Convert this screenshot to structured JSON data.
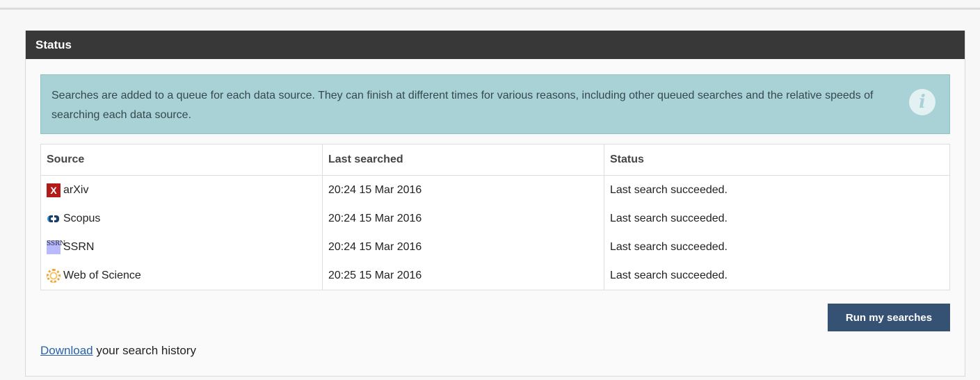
{
  "panel": {
    "title": "Status"
  },
  "info": {
    "text": "Searches are added to a queue for each data source. They can finish at different times for various reasons, including other queued searches and the relative speeds of searching each data source.",
    "icon": "info-icon",
    "icon_glyph": "i"
  },
  "table": {
    "headers": [
      "Source",
      "Last searched",
      "Status"
    ],
    "rows": [
      {
        "source": "arXiv",
        "icon": "arxiv-icon",
        "icon_glyph": "X",
        "last": "20:24 15 Mar 2016",
        "status": "Last search succeeded."
      },
      {
        "source": "Scopus",
        "icon": "scopus-icon",
        "icon_glyph": "",
        "last": "20:24 15 Mar 2016",
        "status": "Last search succeeded."
      },
      {
        "source": "SSRN",
        "icon": "ssrn-icon",
        "icon_glyph": "SSRN",
        "last": "20:24 15 Mar 2016",
        "status": "Last search succeeded."
      },
      {
        "source": "Web of Science",
        "icon": "web-of-science-icon",
        "icon_glyph": "",
        "last": "20:25 15 Mar 2016",
        "status": "Last search succeeded."
      }
    ]
  },
  "actions": {
    "run_label": "Run my searches"
  },
  "footer": {
    "link_text": "Download",
    "rest_text": " your search history"
  },
  "colors": {
    "header_bg": "#383838",
    "info_bg": "#a9d2d7",
    "button_bg": "#355173",
    "link": "#2a62a6"
  }
}
